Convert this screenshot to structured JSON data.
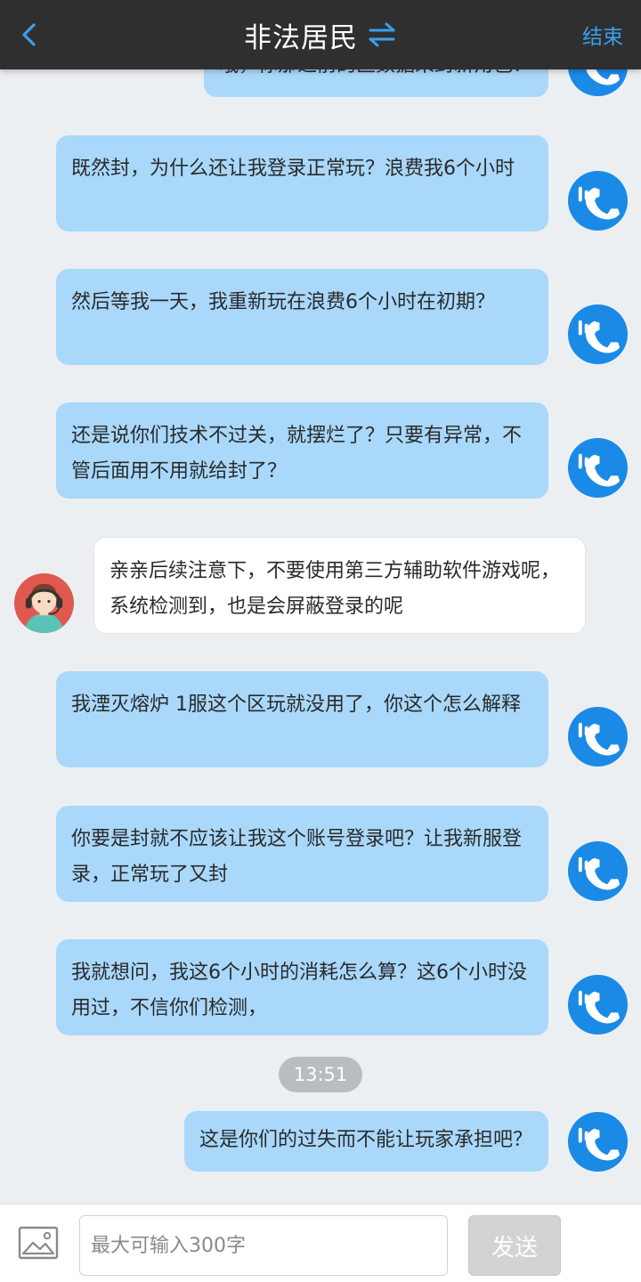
{
  "header": {
    "title": "非法居民",
    "end_label": "结束"
  },
  "messages": [
    {
      "sender": "user",
      "text": "哦，你那之前的区数据来封新角色？"
    },
    {
      "sender": "user",
      "text": "既然封，为什么还让我登录正常玩？浪费我6个小时"
    },
    {
      "sender": "user",
      "text": "然后等我一天，我重新玩在浪费6个小时在初期？"
    },
    {
      "sender": "user",
      "text": "还是说你们技术不过关，就摆烂了？只要有异常，不管后面用不用就给封了？"
    },
    {
      "sender": "agent",
      "text": "亲亲后续注意下，不要使用第三方辅助软件游戏呢，系统检测到，也是会屏蔽登录的呢"
    },
    {
      "sender": "user",
      "text": "我湮灭熔炉 1服这个区玩就没用了，你这个怎么解释"
    },
    {
      "sender": "user",
      "text": "你要是封就不应该让我这个账号登录吧？让我新服登录，正常玩了又封"
    },
    {
      "sender": "user",
      "text": "我就想问，我这6个小时的消耗怎么算？这6个小时没用过，不信你们检测，"
    },
    {
      "sender": "user",
      "text": "这是你们的过失而不能让玩家承担吧？"
    }
  ],
  "timestamp": "13:51",
  "input_bar": {
    "placeholder": "最大可输入300字",
    "send_label": "发送"
  },
  "colors": {
    "header_bg": "#2f2f2f",
    "accent": "#3aa0ee",
    "user_bubble": "#a9d8fb",
    "agent_bubble": "#ffffff",
    "background": "#eceff2"
  },
  "icons": {
    "back": "chevron-left-icon",
    "switch": "swap-arrows-icon",
    "user_avatar": "phone-app-icon",
    "agent_avatar": "headset-agent-icon",
    "image": "image-icon"
  }
}
